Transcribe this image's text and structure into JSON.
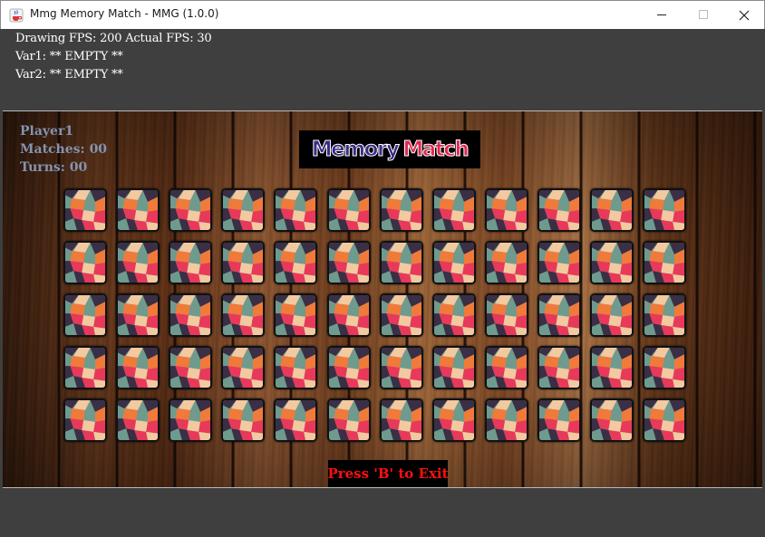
{
  "window": {
    "title": "Mmg Memory Match - MMG (1.0.0)",
    "icon": "java-cup-icon",
    "controls": [
      "minimize-icon",
      "maximize-icon",
      "close-icon"
    ]
  },
  "debug": {
    "fps_line": "Drawing FPS: 200 Actual FPS: 30",
    "var1_line": "Var1: ** EMPTY **",
    "var2_line": "Var2: ** EMPTY **"
  },
  "hud": {
    "player": "Player1",
    "matches": "Matches: 00",
    "turns": "Turns: 00",
    "color": "#8593b0"
  },
  "logo": {
    "word1": "Memory",
    "word2": "Match",
    "color1": "#3b2b86",
    "color2": "#e2284f"
  },
  "board": {
    "rows": 5,
    "columns": 12,
    "card_state": "face-down",
    "card_back_colors": [
      "#6f9a8e",
      "#e8395a",
      "#f07a3a",
      "#f3c9a0",
      "#3a2f45"
    ]
  },
  "exit_prompt": {
    "text": "Press 'B' to Exit",
    "color": "#ff1010"
  }
}
